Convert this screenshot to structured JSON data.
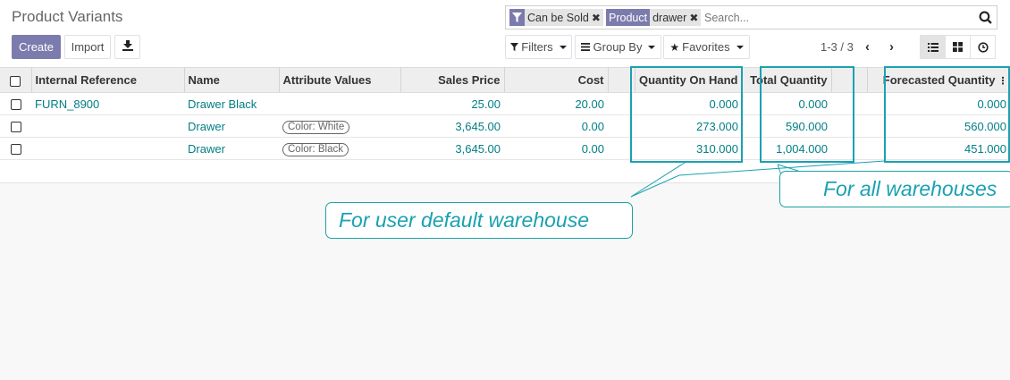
{
  "page": {
    "title": "Product Variants"
  },
  "toolbar": {
    "create_label": "Create",
    "import_label": "Import"
  },
  "search": {
    "facets": [
      {
        "icon": "filter-icon",
        "value": "Can be Sold"
      },
      {
        "icon_label": "Product",
        "value": "drawer"
      }
    ],
    "placeholder": "Search..."
  },
  "filters": {
    "filters_label": "Filters",
    "groupby_label": "Group By",
    "favorites_label": "Favorites"
  },
  "pager": {
    "value": "1-3 / 3"
  },
  "table": {
    "headers": [
      "Internal Reference",
      "Name",
      "Attribute Values",
      "Sales Price",
      "Cost",
      "Quantity On Hand",
      "Total Quantity",
      "Forecasted Quantity"
    ],
    "rows": [
      {
        "internal_reference": "FURN_8900",
        "name": "Drawer Black",
        "attribute": "",
        "sales_price": "25.00",
        "cost": "20.00",
        "qty_on_hand": "0.000",
        "total_qty": "0.000",
        "forecasted_qty": "0.000"
      },
      {
        "internal_reference": "",
        "name": "Drawer",
        "attribute": "Color: White",
        "sales_price": "3,645.00",
        "cost": "0.00",
        "qty_on_hand": "273.000",
        "total_qty": "590.000",
        "forecasted_qty": "560.000"
      },
      {
        "internal_reference": "",
        "name": "Drawer",
        "attribute": "Color: Black",
        "sales_price": "3,645.00",
        "cost": "0.00",
        "qty_on_hand": "310.000",
        "total_qty": "1,004.000",
        "forecasted_qty": "451.000"
      }
    ]
  },
  "annotations": {
    "user_default": "For user default warehouse",
    "all_warehouses": "For all warehouses",
    "color": "#1aa1b2"
  }
}
